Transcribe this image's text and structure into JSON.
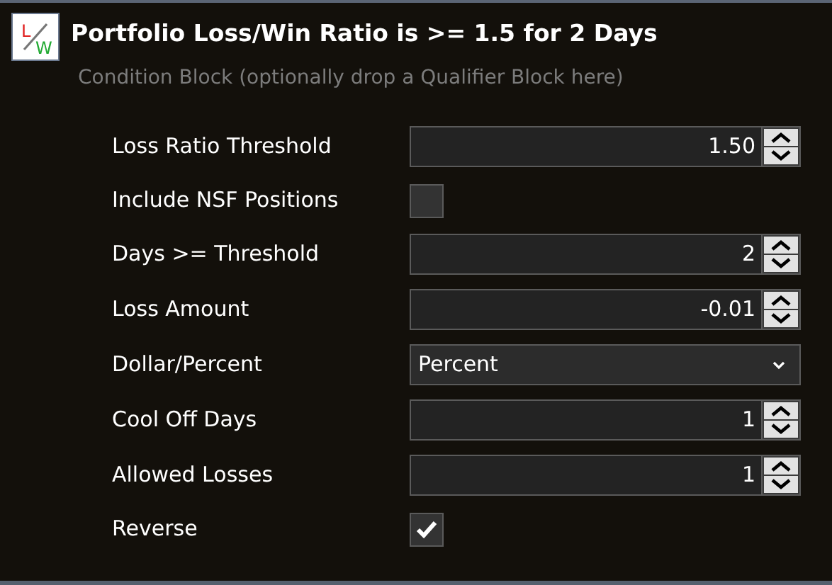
{
  "header": {
    "logo": {
      "top_letter": "L",
      "bottom_letter": "W"
    },
    "title": "Portfolio Loss/Win Ratio is >= 1.5 for 2 Days",
    "subtitle": "Condition Block (optionally drop a Qualifier Block here)"
  },
  "fields": [
    {
      "kind": "spin",
      "label": "Loss Ratio Threshold",
      "value": "1.50"
    },
    {
      "kind": "checkbox",
      "label": "Include NSF Positions",
      "checked": false
    },
    {
      "kind": "spin",
      "label": "Days >= Threshold",
      "value": "2"
    },
    {
      "kind": "spin",
      "label": "Loss Amount",
      "value": "-0.01"
    },
    {
      "kind": "select",
      "label": "Dollar/Percent",
      "value": "Percent"
    },
    {
      "kind": "spin",
      "label": "Cool Off Days",
      "value": "1"
    },
    {
      "kind": "spin",
      "label": "Allowed Losses",
      "value": "1"
    },
    {
      "kind": "checkbox",
      "label": "Reverse",
      "checked": true
    }
  ]
}
